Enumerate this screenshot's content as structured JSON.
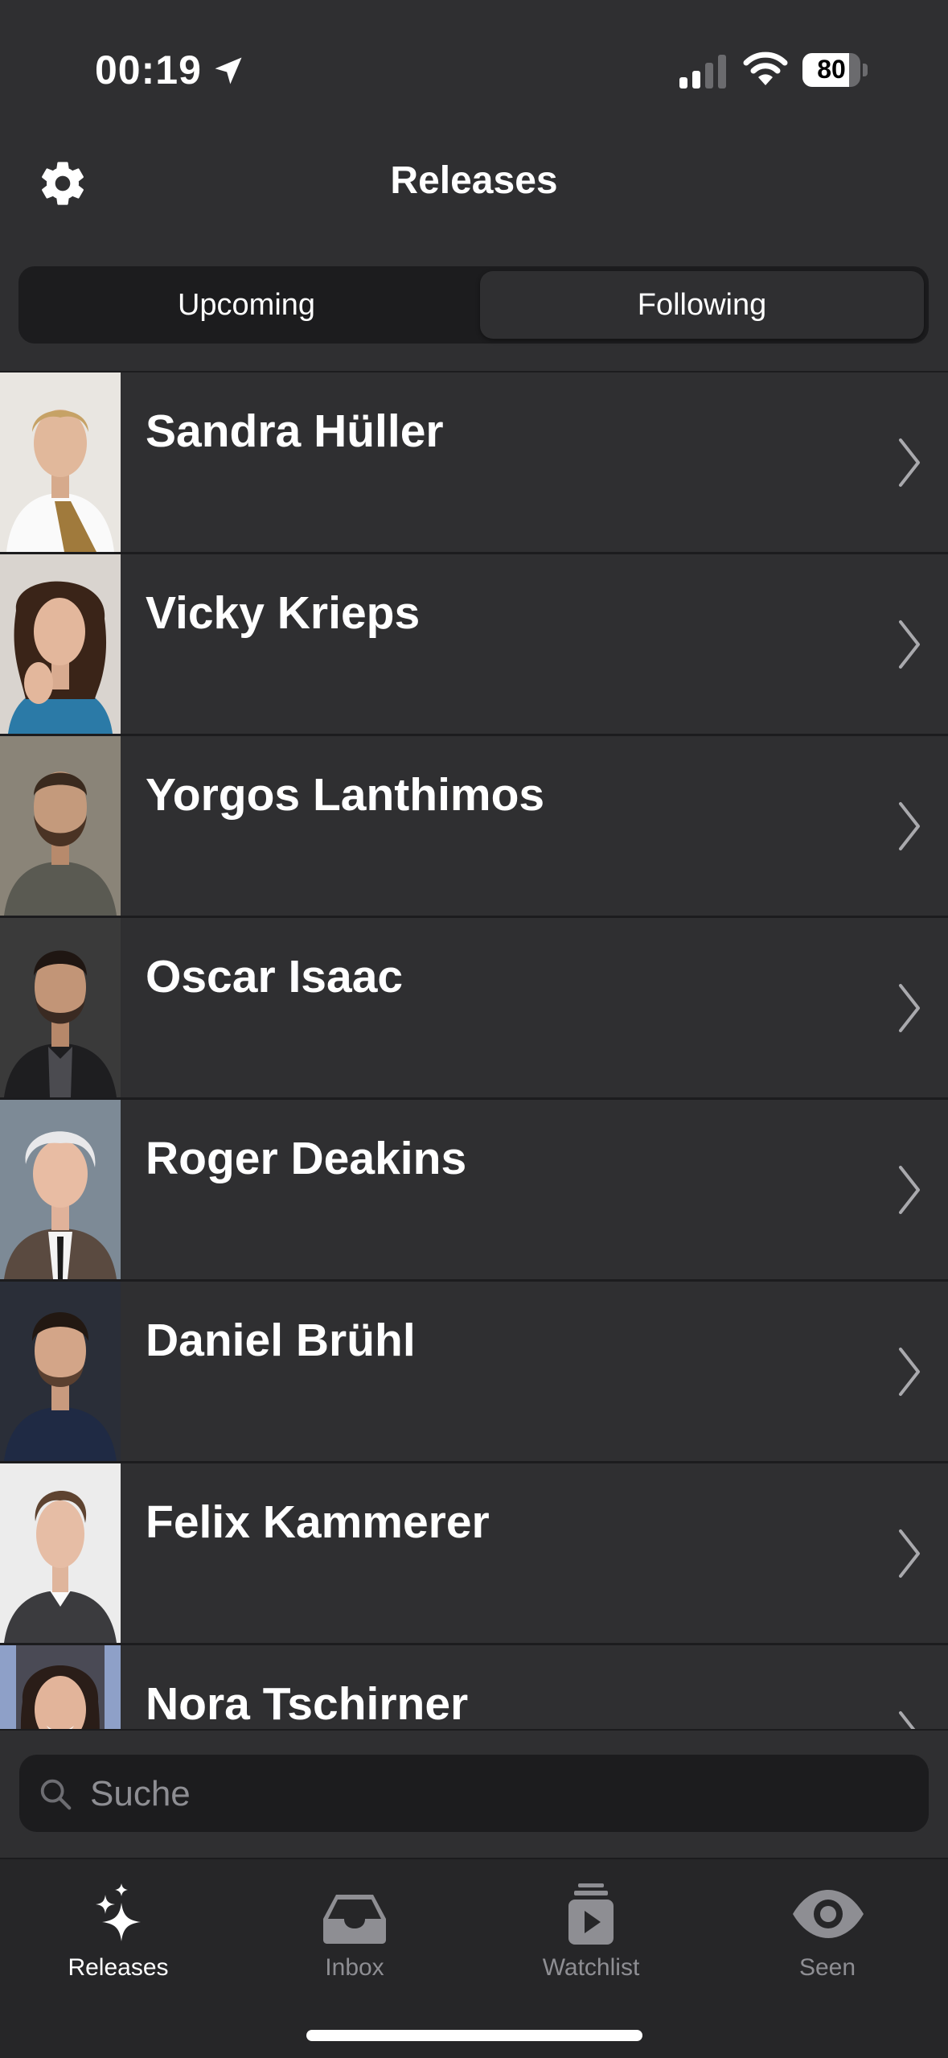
{
  "status_bar": {
    "time": "00:19",
    "battery": "80",
    "battery_level": 0.8
  },
  "nav": {
    "title": "Releases"
  },
  "segments": {
    "upcoming": "Upcoming",
    "following": "Following",
    "selected": "Following"
  },
  "people": [
    {
      "name": "Sandra Hüller"
    },
    {
      "name": "Vicky Krieps"
    },
    {
      "name": "Yorgos Lanthimos"
    },
    {
      "name": "Oscar Isaac"
    },
    {
      "name": "Roger Deakins"
    },
    {
      "name": "Daniel Brühl"
    },
    {
      "name": "Felix Kammerer"
    },
    {
      "name": "Nora Tschirner"
    }
  ],
  "search": {
    "placeholder": "Suche"
  },
  "tabs": [
    {
      "label": "Releases",
      "icon": "sparkles-icon",
      "active": true
    },
    {
      "label": "Inbox",
      "icon": "tray-icon",
      "active": false
    },
    {
      "label": "Watchlist",
      "icon": "play-stack-icon",
      "active": false
    },
    {
      "label": "Seen",
      "icon": "eye-icon",
      "active": false
    }
  ],
  "colors": {
    "background": "#2f2f31",
    "separator": "#1c1c1e",
    "active_tab": "#ffffff",
    "inactive_tab": "#8e8e93"
  }
}
